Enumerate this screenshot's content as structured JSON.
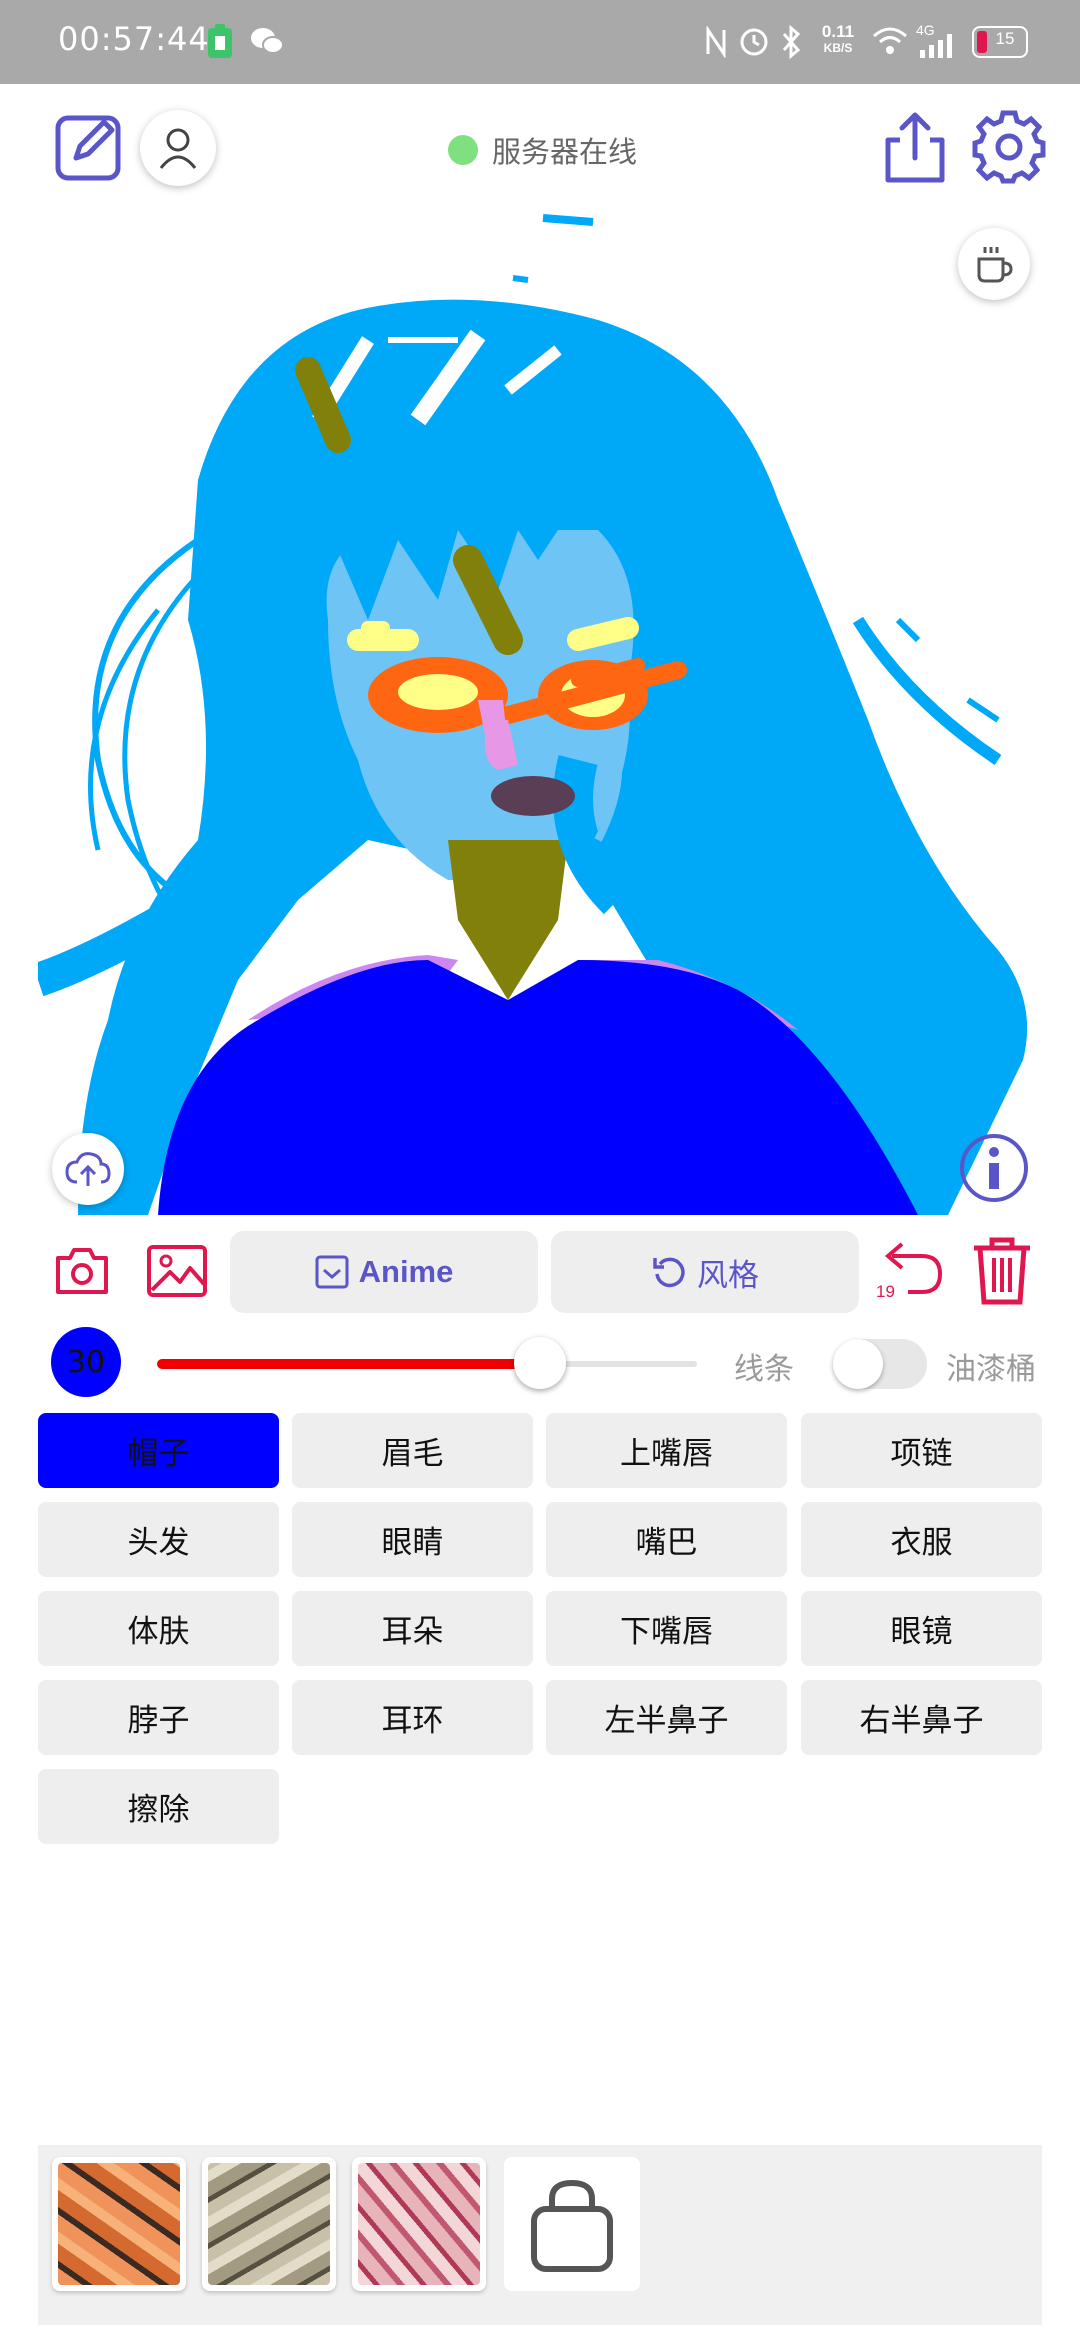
{
  "status_bar": {
    "time": "00:57:44",
    "net_speed_value": "0.11",
    "net_speed_unit": "KB/S",
    "network_type": "4G",
    "battery_level": "15"
  },
  "header": {
    "server_status_text": "服务器在线",
    "server_status_color": "#7fe07f"
  },
  "toolbar": {
    "anime_label": "Anime",
    "style_label": "风格",
    "undo_count": "19"
  },
  "brush": {
    "size": "30",
    "size_fraction": 0.71,
    "color": "#0000ff",
    "slider_color": "#f00000",
    "mode_line_label": "线条",
    "mode_bucket_label": "油漆桶",
    "bucket_enabled": false
  },
  "labels": [
    {
      "text": "帽子",
      "selected": true
    },
    {
      "text": "眉毛"
    },
    {
      "text": "上嘴唇"
    },
    {
      "text": "项链"
    },
    {
      "text": "头发"
    },
    {
      "text": "眼睛"
    },
    {
      "text": "嘴巴"
    },
    {
      "text": "衣服"
    },
    {
      "text": "体肤"
    },
    {
      "text": "耳朵"
    },
    {
      "text": "下嘴唇"
    },
    {
      "text": "眼镜"
    },
    {
      "text": "脖子"
    },
    {
      "text": "耳环"
    },
    {
      "text": "左半鼻子"
    },
    {
      "text": "右半鼻子"
    },
    {
      "text": "擦除"
    }
  ],
  "style_presets": [
    {
      "icon": "style-thumb-orange",
      "color": "#e07a3a"
    },
    {
      "icon": "style-thumb-gray",
      "color": "#a39a82"
    },
    {
      "icon": "style-thumb-pink",
      "color": "#c25870"
    },
    {
      "icon": "shopping-bag-icon"
    }
  ],
  "colors": {
    "accent_purple": "#5b56c8",
    "accent_red": "#e0174f"
  }
}
